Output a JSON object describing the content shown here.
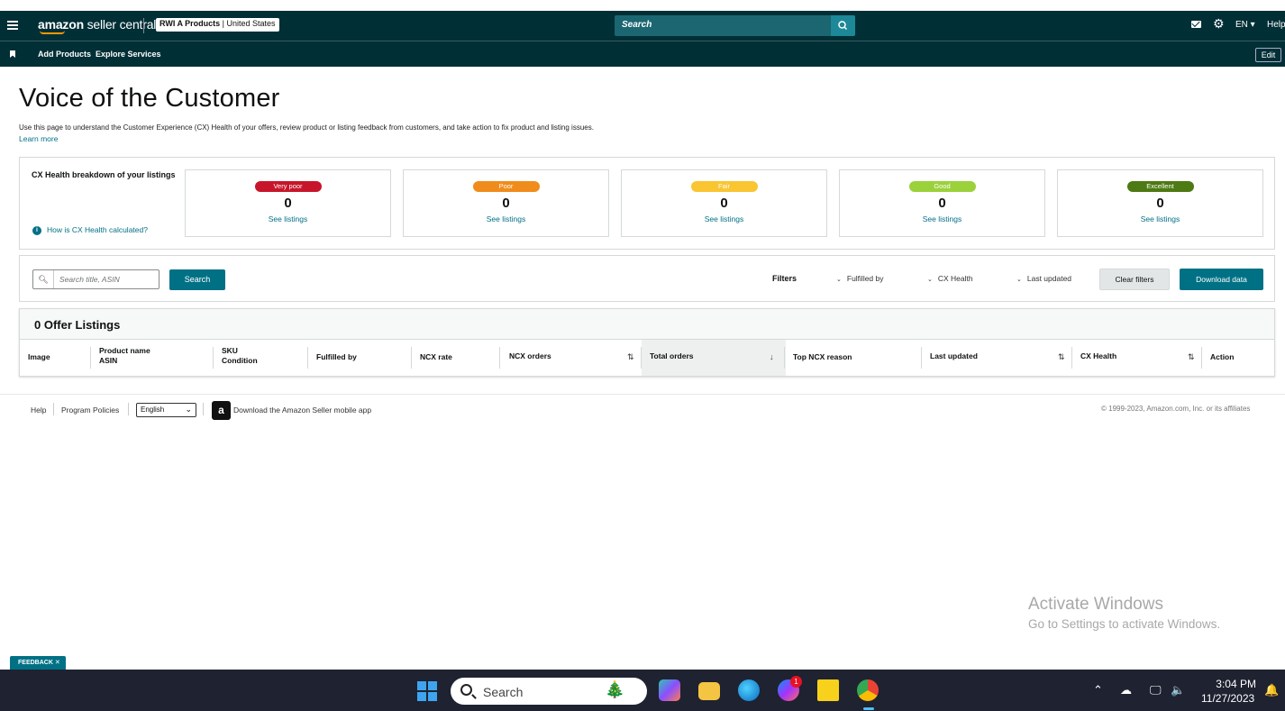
{
  "topbar": {
    "logo_bold": "amazon",
    "logo_light": " seller central",
    "account_store": "RWI A Products",
    "account_region": " | United States",
    "search_placeholder": "Search",
    "lang": "EN ▾",
    "help": "Help"
  },
  "navbar": {
    "add_products": "Add Products",
    "explore_services": "Explore Services",
    "edit": "Edit"
  },
  "page": {
    "title": "Voice of the Customer",
    "intro": "Use this page to understand the Customer Experience (CX) Health of your offers, review product or listing feedback from customers, and take action to fix product and listing issues.",
    "learn_more": "Learn more"
  },
  "cx_health": {
    "title": "CX Health breakdown of your listings",
    "how_link": "How is CX Health calculated?",
    "cards": [
      {
        "label": "Very poor",
        "count": "0",
        "link": "See listings",
        "color": "#c7162b"
      },
      {
        "label": "Poor",
        "count": "0",
        "link": "See listings",
        "color": "#f08c1c"
      },
      {
        "label": "Fair",
        "count": "0",
        "link": "See listings",
        "color": "#f9c531"
      },
      {
        "label": "Good",
        "count": "0",
        "link": "See listings",
        "color": "#9bd13b"
      },
      {
        "label": "Excellent",
        "count": "0",
        "link": "See listings",
        "color": "#4d7a12"
      }
    ]
  },
  "filters": {
    "search_placeholder": "Search title, ASIN",
    "search_button": "Search",
    "label": "Filters",
    "fulfilled_by": "Fulfilled by",
    "cx_health": "CX Health",
    "last_updated": "Last updated",
    "clear": "Clear filters",
    "download": "Download data"
  },
  "table": {
    "title": "0 Offer Listings",
    "columns": {
      "image": "Image",
      "product_name": "Product name",
      "asin": "ASIN",
      "sku": "SKU",
      "condition": "Condition",
      "fulfilled_by": "Fulfilled by",
      "ncx_rate": "NCX rate",
      "ncx_orders": "NCX orders",
      "total_orders": "Total orders",
      "top_ncx_reason": "Top NCX reason",
      "last_updated": "Last updated",
      "cx_health": "CX Health",
      "action": "Action"
    }
  },
  "footer": {
    "help": "Help",
    "policies": "Program Policies",
    "language": "English",
    "app": "Download the Amazon Seller mobile app",
    "copyright": "© 1999-2023, Amazon.com, Inc. or its affiliates"
  },
  "watermark": {
    "line1": "Activate Windows",
    "line2": "Go to Settings to activate Windows."
  },
  "feedback": "FEEDBACK ✕",
  "taskbar": {
    "search": "Search",
    "time": "3:04 PM",
    "date": "11/27/2023",
    "messenger_badge": "1"
  }
}
